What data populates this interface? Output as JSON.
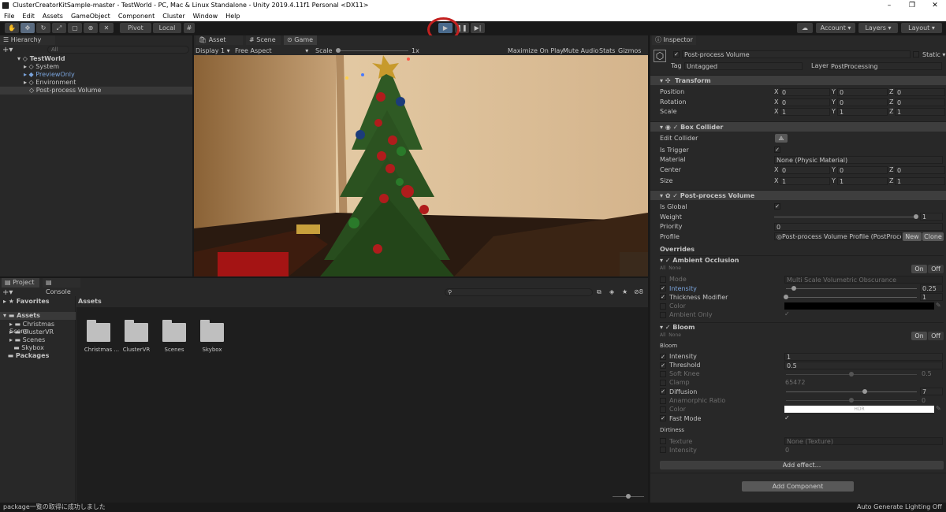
{
  "window": {
    "title": "ClusterCreatorKitSample-master - TestWorld - PC, Mac & Linux Standalone - Unity 2019.4.11f1 Personal <DX11>",
    "minimize": "–",
    "maximize": "❐",
    "close": "✕"
  },
  "menu": [
    "File",
    "Edit",
    "Assets",
    "GameObject",
    "Component",
    "Cluster",
    "Window",
    "Help"
  ],
  "toolbar": {
    "pivot": "Pivot",
    "local": "Local",
    "account": "Account",
    "layers": "Layers",
    "layout": "Layout"
  },
  "hierarchy": {
    "tab": "Hierarchy",
    "search_placeholder": "All",
    "items": [
      {
        "label": "TestWorld",
        "depth": 0,
        "highlight": false
      },
      {
        "label": "System",
        "depth": 1,
        "highlight": false
      },
      {
        "label": "PreviewOnly",
        "depth": 1,
        "highlight": true
      },
      {
        "label": "Environment",
        "depth": 1,
        "highlight": false
      },
      {
        "label": "Post-process Volume",
        "depth": 1,
        "highlight": false,
        "selected": true
      }
    ]
  },
  "sceneTabs": [
    "Asset Store",
    "Scene",
    "Game"
  ],
  "gameBar": {
    "display": "Display 1",
    "aspect": "Free Aspect",
    "scale_label": "Scale",
    "scale_value": "1x",
    "maximize": "Maximize On Play",
    "mute": "Mute Audio",
    "stats": "Stats",
    "gizmos": "Gizmos"
  },
  "project": {
    "tabs": [
      "Project",
      "Console"
    ],
    "favorites": "Favorites",
    "assets": "Assets",
    "tree": [
      "Christmas Scene",
      "ClusterVR",
      "Scenes",
      "Skybox"
    ],
    "packages": "Packages",
    "header": "Assets",
    "folders": [
      "Christmas ...",
      "ClusterVR",
      "Scenes",
      "Skybox"
    ],
    "badge": "8"
  },
  "inspector": {
    "tab": "Inspector",
    "object_name": "Post-process Volume",
    "static": "Static",
    "tag_label": "Tag",
    "tag": "Untagged",
    "layer_label": "Layer",
    "layer": "PostProcessing",
    "transform": {
      "title": "Transform",
      "rows": [
        {
          "label": "Position",
          "x": "0",
          "y": "0",
          "z": "0"
        },
        {
          "label": "Rotation",
          "x": "0",
          "y": "0",
          "z": "0"
        },
        {
          "label": "Scale",
          "x": "1",
          "y": "1",
          "z": "1"
        }
      ]
    },
    "boxCollider": {
      "title": "Box Collider",
      "edit": "Edit Collider",
      "trigger": "Is Trigger",
      "material_label": "Material",
      "material": "None (Physic Material)",
      "center": {
        "label": "Center",
        "x": "0",
        "y": "0",
        "z": "0"
      },
      "size": {
        "label": "Size",
        "x": "1",
        "y": "1",
        "z": "1"
      }
    },
    "ppv": {
      "title": "Post-process Volume",
      "isGlobal": "Is Global",
      "weight_label": "Weight",
      "weight": "1",
      "weight_level": 1,
      "priority_label": "Priority",
      "priority": "0",
      "profile_label": "Profile",
      "profile": "Post-process Volume Profile (PostProce",
      "new": "New",
      "clone": "Clone",
      "overrides": "Overrides"
    },
    "ao": {
      "title": "Ambient Occlusion",
      "all": "All",
      "none": "None",
      "on": "On",
      "off": "Off",
      "mode_label": "Mode",
      "mode": "Multi Scale Volumetric Obscurance",
      "intensity_label": "Intensity",
      "intensity": "0.25",
      "intensity_level": 0.06,
      "thick_label": "Thickness Modifier",
      "thick": "1",
      "thick_level": 0,
      "color_label": "Color",
      "ambient_label": "Ambient Only"
    },
    "bloom": {
      "title": "Bloom",
      "all": "All",
      "none": "None",
      "on": "On",
      "off": "Off",
      "section": "Bloom",
      "intensity_label": "Intensity",
      "intensity": "1",
      "threshold_label": "Threshold",
      "threshold": "0.5",
      "softknee_label": "Soft Knee",
      "softknee": "0.5",
      "softknee_level": 0.5,
      "clamp_label": "Clamp",
      "clamp": "65472",
      "diffusion_label": "Diffusion",
      "diffusion": "7",
      "diffusion_level": 0.6,
      "anamorphic_label": "Anamorphic Ratio",
      "anamorphic": "0",
      "anamorphic_level": 0.5,
      "color_label": "Color",
      "hdr": "HDR",
      "fast_label": "Fast Mode",
      "dirt_section": "Dirtiness",
      "texture_label": "Texture",
      "texture": "None (Texture)",
      "dirt_intensity_label": "Intensity",
      "dirt_intensity": "0"
    },
    "add_effect": "Add effect...",
    "add_component": "Add Component"
  },
  "status": {
    "left": "package一覧の取得に成功しました",
    "right": "Auto Generate Lighting Off"
  },
  "colors": {
    "accent": "#4a6a8c",
    "selection": "#393939",
    "highlight_text": "#7aa4dc",
    "play_circle": "#c3201f"
  }
}
